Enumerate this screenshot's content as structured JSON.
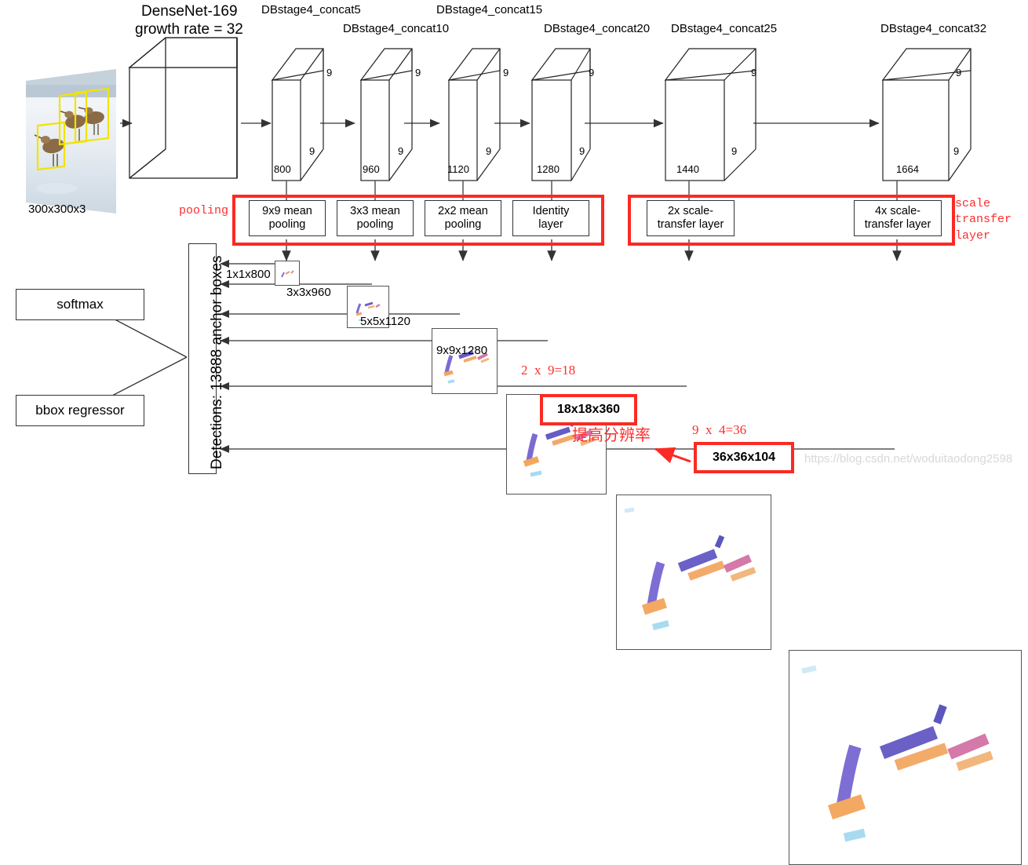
{
  "diagram": {
    "title_lines": [
      "DenseNet-169",
      "growth rate = 32"
    ],
    "input": {
      "caption": "300x300x3"
    },
    "stage_labels": [
      "DBstage4_concat5",
      "DBstage4_concat10",
      "DBstage4_concat15",
      "DBstage4_concat20",
      "DBstage4_concat25",
      "DBstage4_concat32"
    ],
    "cubes": [
      {
        "channels": "800",
        "dim_top": "9",
        "dim_bottom": "9"
      },
      {
        "channels": "960",
        "dim_top": "9",
        "dim_bottom": "9"
      },
      {
        "channels": "1120",
        "dim_top": "9",
        "dim_bottom": "9"
      },
      {
        "channels": "1280",
        "dim_top": "9",
        "dim_bottom": "9"
      },
      {
        "channels": "1440",
        "dim_top": "9",
        "dim_bottom": "9"
      },
      {
        "channels": "1664",
        "dim_top": "9",
        "dim_bottom": "9"
      }
    ],
    "pooling_group": {
      "red_label": "pooling",
      "items": [
        {
          "line1": "9x9 mean",
          "line2": "pooling"
        },
        {
          "line1": "3x3 mean",
          "line2": "pooling"
        },
        {
          "line1": "2x2 mean",
          "line2": "pooling"
        },
        {
          "line1": "Identity",
          "line2": "layer"
        }
      ]
    },
    "scale_group": {
      "red_label": "scale\ntransfer\nlayer",
      "items": [
        {
          "line1": "2x scale-",
          "line2": "transfer layer"
        },
        {
          "line1": "4x scale-",
          "line2": "transfer layer"
        }
      ]
    },
    "detections": {
      "label": "Detections: 13888 anchor boxes"
    },
    "heads": [
      {
        "label": "softmax"
      },
      {
        "label": "bbox regressor"
      }
    ],
    "feature_maps": [
      {
        "caption": "1x1x800"
      },
      {
        "caption": "3x3x960"
      },
      {
        "caption": "5x5x1120"
      },
      {
        "caption": "9x9x1280"
      },
      {
        "caption": ""
      },
      {
        "caption": ""
      }
    ],
    "red_annotations": {
      "anchors_2x9": "2  x  9=18",
      "box_18": "18x18x360",
      "chinese_note": "提高分辨率",
      "anchors_9x4": "9  x  4=36",
      "box_36": "36x36x104"
    },
    "watermark": "https://blog.csdn.net/woduitaodong2598",
    "colors": {
      "red": "#fb2a24",
      "red_text": "#ff2d2d",
      "line": "#555555",
      "yellow_bbox": "#f2e300"
    }
  }
}
